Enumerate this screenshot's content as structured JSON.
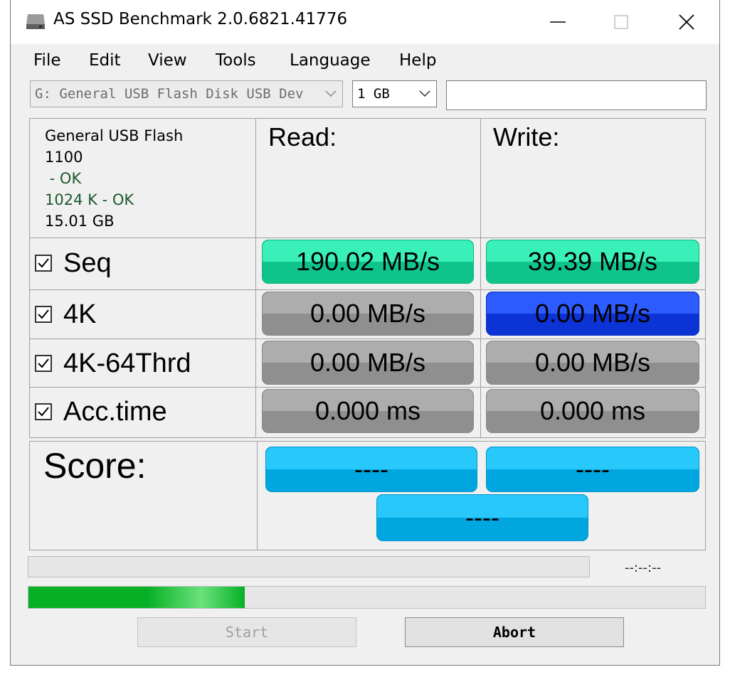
{
  "window": {
    "title": "AS SSD Benchmark 2.0.6821.41776"
  },
  "menu": {
    "items": [
      "File",
      "Edit",
      "View",
      "Tools",
      "Language",
      "Help"
    ]
  },
  "toolbar": {
    "drive_select_value": "G: General USB Flash Disk USB Dev",
    "size_select_value": "1 GB",
    "extra_input_value": ""
  },
  "info": {
    "device_name": "General USB Flash",
    "firmware": "1100",
    "driver_status": " - OK",
    "alignment": "1024 K - OK",
    "capacity": "15.01 GB"
  },
  "headers": {
    "read": "Read:",
    "write": "Write:"
  },
  "rows": [
    {
      "label": "Seq",
      "checked": true,
      "read": "190.02 MB/s",
      "write": "39.39 MB/s",
      "read_state": "done",
      "write_state": "done"
    },
    {
      "label": "4K",
      "checked": true,
      "read": "0.00 MB/s",
      "write": "0.00 MB/s",
      "read_state": "pending",
      "write_state": "running"
    },
    {
      "label": "4K-64Thrd",
      "checked": true,
      "read": "0.00 MB/s",
      "write": "0.00 MB/s",
      "read_state": "pending",
      "write_state": "pending"
    },
    {
      "label": "Acc.time",
      "checked": true,
      "read": "0.000 ms",
      "write": "0.000 ms",
      "read_state": "pending",
      "write_state": "pending"
    }
  ],
  "score": {
    "label": "Score:",
    "read": "----",
    "write": "----",
    "total": "----"
  },
  "progress": {
    "elapsed_time": "--:--:--",
    "overall_fraction": 0.0,
    "test_fraction": 0.32
  },
  "buttons": {
    "start": "Start",
    "abort": "Abort"
  },
  "colors": {
    "done": "#0ec48a",
    "running": "#0c33d6",
    "pending": "#8f8f8f",
    "score": "#00a6df",
    "progress": "#06b025"
  }
}
